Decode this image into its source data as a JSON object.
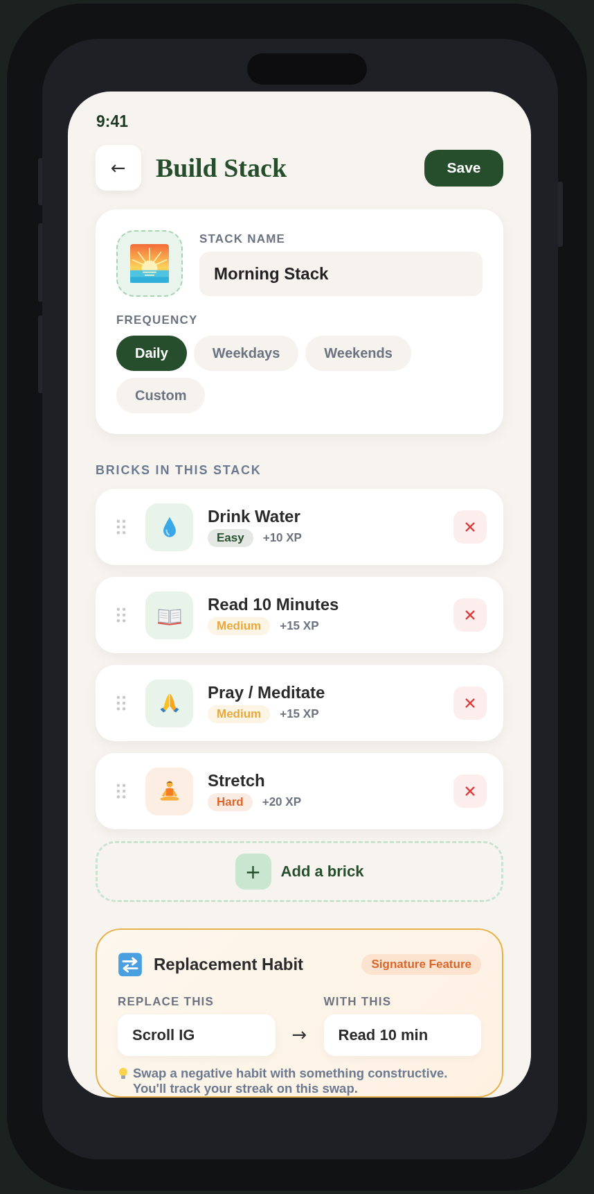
{
  "status_bar": {
    "time": "9:41"
  },
  "header": {
    "back": "←",
    "title": "Build Stack",
    "save": "Save"
  },
  "stack": {
    "name_label": "STACK NAME",
    "name": "Morning Stack",
    "frequency_label": "FREQUENCY",
    "frequencies": [
      {
        "label": "Daily",
        "selected": true
      },
      {
        "label": "Weekdays",
        "selected": false
      },
      {
        "label": "Weekends",
        "selected": false
      },
      {
        "label": "Custom",
        "selected": false
      }
    ]
  },
  "bricks_title": "BRICKS IN THIS STACK",
  "bricks": [
    {
      "kind": "droplet",
      "name": "Drink Water",
      "difficulty": "Easy",
      "color": "#264d2c",
      "xp": "+10 XP"
    },
    {
      "kind": "book",
      "name": "Read 10 Minutes",
      "difficulty": "Medium",
      "color": "#e8a93a",
      "xp": "+15 XP"
    },
    {
      "kind": "hands",
      "name": "Pray / Meditate",
      "difficulty": "Medium",
      "color": "#e8a93a",
      "xp": "+15 XP"
    },
    {
      "kind": "lotus",
      "name": "Stretch",
      "difficulty": "Hard",
      "color": "#d9662b",
      "xp": "+20 XP"
    }
  ],
  "add_brick": {
    "icon": "+",
    "label": "Add a brick"
  },
  "replacement": {
    "title": "Replacement Habit",
    "badge": "Signature Feature",
    "replace_label": "REPLACE THIS",
    "replace_value": "Scroll IG",
    "arrow": "→",
    "with_label": "WITH THIS",
    "with_value": "Read 10 min",
    "hint": "Swap a negative habit with something constructive. You'll track your streak on this swap."
  }
}
